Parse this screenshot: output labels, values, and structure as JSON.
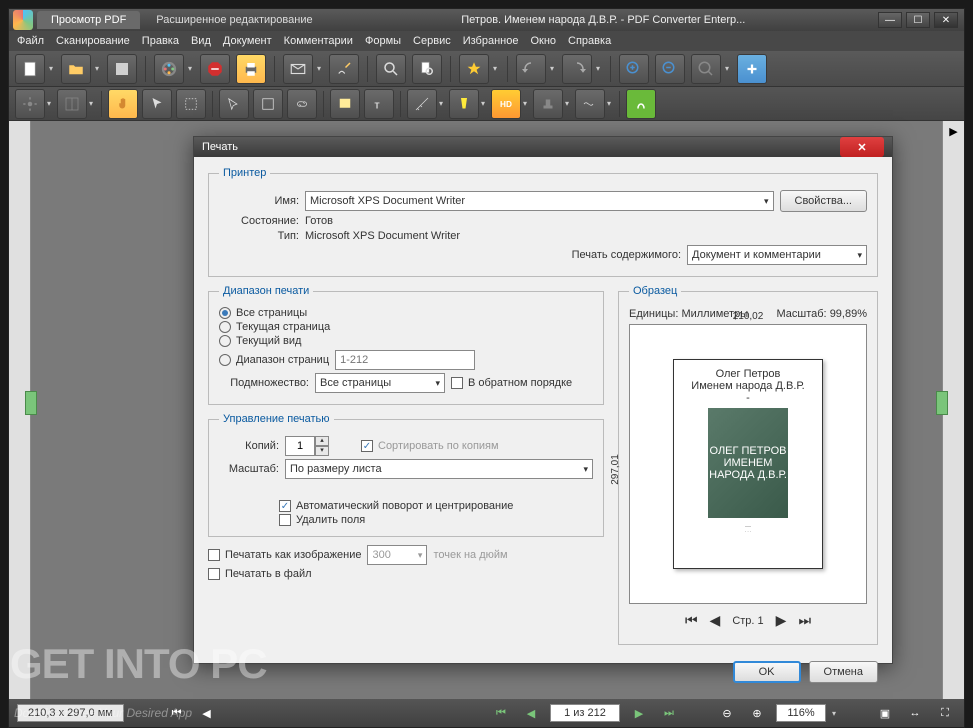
{
  "tabs": {
    "view": "Просмотр PDF",
    "edit": "Расширенное редактирование"
  },
  "doctitle": "Петров. Именем народа Д.В.Р. - PDF Converter Enterp...",
  "menu": {
    "file": "Файл",
    "scan": "Сканирование",
    "edit": "Правка",
    "view": "Вид",
    "doc": "Документ",
    "comment": "Комментарии",
    "forms": "Формы",
    "service": "Сервис",
    "fav": "Избранное",
    "window": "Окно",
    "help": "Справка"
  },
  "status": {
    "size": "210,3 x 297,0 мм",
    "page": "1 из 212",
    "zoom": "116%"
  },
  "dlg": {
    "title": "Печать",
    "printer_group": "Принтер",
    "name_lbl": "Имя:",
    "name_val": "Microsoft XPS Document Writer",
    "props_btn": "Свойства...",
    "state_lbl": "Состояние:",
    "state_val": "Готов",
    "type_lbl": "Тип:",
    "type_val": "Microsoft XPS Document Writer",
    "content_lbl": "Печать содержимого:",
    "content_val": "Документ и комментарии",
    "range_group": "Диапазон печати",
    "range_all": "Все страницы",
    "range_current": "Текущая страница",
    "range_view": "Текущий вид",
    "range_pages": "Диапазон страниц",
    "range_input": "1-212",
    "subset_lbl": "Подмножество:",
    "subset_val": "Все страницы",
    "reverse": "В обратном порядке",
    "ctrl_group": "Управление печатью",
    "copies_lbl": "Копий:",
    "copies_val": "1",
    "collate": "Сортировать по копиям",
    "scale_lbl": "Масштаб:",
    "scale_val": "По размеру листа",
    "autorotate": "Автоматический поворот и центрирование",
    "remove_margins": "Удалить поля",
    "as_image": "Печатать как изображение",
    "dpi": "300",
    "dpi_lbl": "точек на дюйм",
    "to_file": "Печатать в файл",
    "preview_group": "Образец",
    "units_lbl": "Единицы:",
    "units_val": "Миллиметры",
    "scale_pct_lbl": "Масштаб:",
    "scale_pct_val": "99,89%",
    "dim_w": "210,02",
    "dim_h": "297,01",
    "doc_author": "Олег Петров",
    "doc_title": "Именем народа Д.В.Р.",
    "cover_author": "ОЛЕГ ПЕТРОВ",
    "cover_title": "ИМЕНЕМ НАРОДА Д.В.Р.",
    "page_lbl": "Стр. 1",
    "ok": "OK",
    "cancel": "Отмена"
  },
  "watermark": "GET INTO PC",
  "watermark_sub": "Download Free Your Desired App"
}
